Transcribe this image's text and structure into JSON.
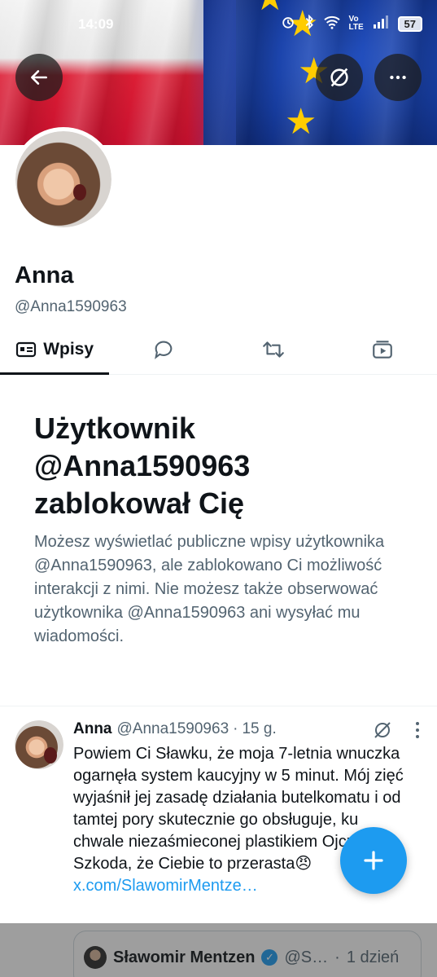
{
  "status_bar": {
    "time": "14:09",
    "battery": "57",
    "icons": [
      "alarm-icon",
      "bluetooth-icon",
      "wifi-icon",
      "volte-icon",
      "signal-icon",
      "battery-icon"
    ],
    "volte": "Vo LTE"
  },
  "header": {
    "back_icon": "arrow-left-icon",
    "grok_icon": "grok-icon",
    "more_icon": "more-horizontal-icon"
  },
  "profile": {
    "name": "Anna",
    "handle": "@Anna1590963"
  },
  "tabs": [
    {
      "label": "Wpisy",
      "icon": "posts-icon",
      "active": true
    },
    {
      "label": "",
      "icon": "reply-icon",
      "active": false
    },
    {
      "label": "",
      "icon": "repost-icon",
      "active": false
    },
    {
      "label": "",
      "icon": "media-icon",
      "active": false
    }
  ],
  "blocked": {
    "title_line1": "Użytkownik",
    "title_line2": "@Anna1590963",
    "title_line3": "zablokował Cię",
    "body": "Możesz wyświetlać publiczne wpisy użytkownika @Anna1590963, ale zablokowano Ci możliwość interakcji z nimi. Nie możesz także obserwować użytkownika @Anna1590963 ani wysyłać mu wiadomości."
  },
  "tweet": {
    "name": "Anna",
    "handle": "@Anna1590963",
    "separator": "·",
    "age": "15 g.",
    "text": "Powiem Ci Sławku, że moja 7-letnia wnuczka ogarnęła system kaucyjny w 5 minut. Mój zięć wyjaśnił jej zasadę działania butelkomatu i od tamtej pory skutecznie go obsługuje, ku chwale niezaśmieconej plastikiem Ojczyzny. Szkoda, że Ciebie to przerasta😠",
    "link": "x.com/SlawomirMentze…"
  },
  "quoted": {
    "name": "Sławomir Mentzen",
    "handle": "@S…",
    "separator": "·",
    "age": "1 dzień"
  },
  "fab": {
    "icon": "plus-icon"
  },
  "colors": {
    "accent": "#1d9bf0",
    "text_primary": "#0f1419",
    "text_secondary": "#536471"
  }
}
